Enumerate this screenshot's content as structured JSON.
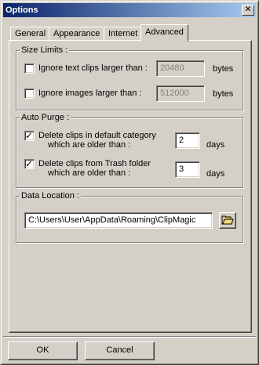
{
  "window": {
    "title": "Options"
  },
  "tabs": [
    {
      "label": "General"
    },
    {
      "label": "Appearance"
    },
    {
      "label": "Internet"
    },
    {
      "label": "Advanced"
    }
  ],
  "size_limits": {
    "legend": "Size Limits :",
    "text_clips": {
      "label": "Ignore text clips larger than :",
      "checked": false,
      "value": "20480",
      "unit": "bytes"
    },
    "images": {
      "label": "Ignore images larger than :",
      "checked": false,
      "value": "512000",
      "unit": "bytes"
    }
  },
  "auto_purge": {
    "legend": "Auto Purge :",
    "default_category": {
      "line1": "Delete clips in default category",
      "line2": "which are older than :",
      "checked": true,
      "value": "2",
      "unit": "days"
    },
    "trash_folder": {
      "line1": "Delete clips from Trash folder",
      "line2": "which are older than :",
      "checked": true,
      "value": "3",
      "unit": "days"
    }
  },
  "data_location": {
    "legend": "Data Location :",
    "path": "C:\\Users\\User\\AppData\\Roaming\\ClipMagic",
    "browse_icon": "open-folder-icon"
  },
  "buttons": {
    "ok": "OK",
    "cancel": "Cancel"
  }
}
